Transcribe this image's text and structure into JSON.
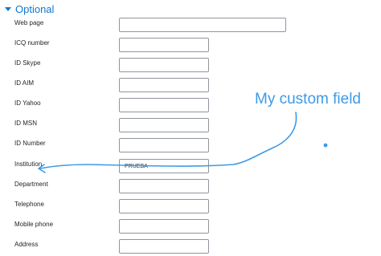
{
  "section": {
    "title": "Optional",
    "expanded": true
  },
  "fields": [
    {
      "key": "web_page",
      "label": "Web page",
      "value": ""
    },
    {
      "key": "icq_number",
      "label": "ICQ number",
      "value": ""
    },
    {
      "key": "id_skype",
      "label": "ID Skype",
      "value": ""
    },
    {
      "key": "id_aim",
      "label": "ID AIM",
      "value": ""
    },
    {
      "key": "id_yahoo",
      "label": "ID Yahoo",
      "value": ""
    },
    {
      "key": "id_msn",
      "label": "ID MSN",
      "value": ""
    },
    {
      "key": "id_number",
      "label": "ID Number",
      "value": ""
    },
    {
      "key": "institution",
      "label": "Institution",
      "value": "PRUEBA"
    },
    {
      "key": "department",
      "label": "Department",
      "value": ""
    },
    {
      "key": "telephone",
      "label": "Telephone",
      "value": ""
    },
    {
      "key": "mobile_phone",
      "label": "Mobile phone",
      "value": ""
    },
    {
      "key": "address",
      "label": "Address",
      "value": ""
    }
  ],
  "annotation": {
    "text": "My custom field",
    "color": "#3d9ae8"
  },
  "colors": {
    "accent": "#1177d1",
    "border": "#8f959e",
    "text": "#1d2125"
  }
}
